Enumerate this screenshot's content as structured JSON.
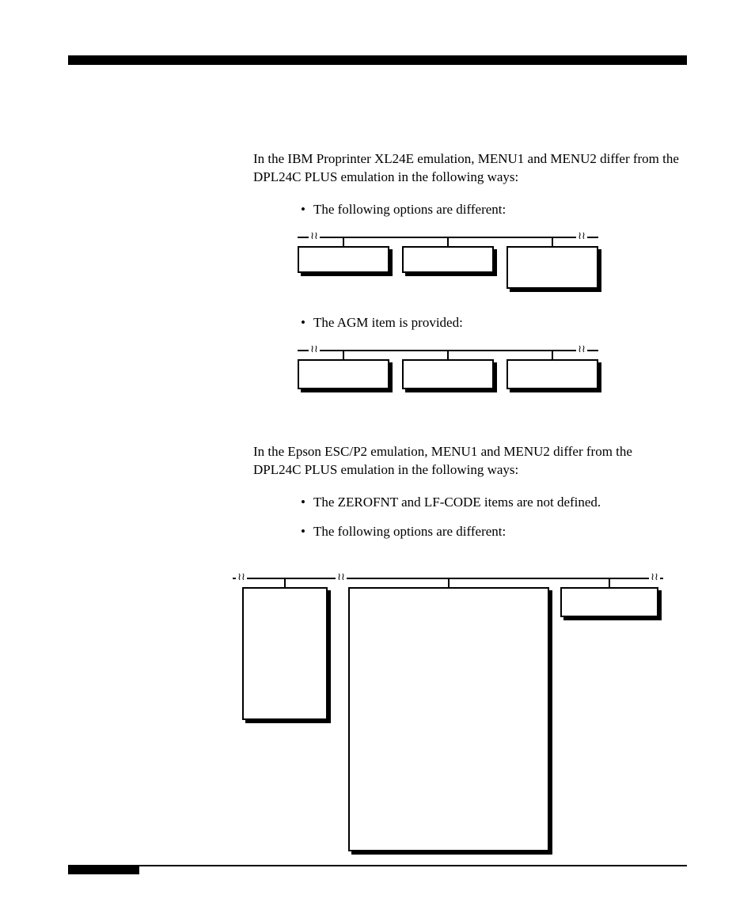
{
  "section1": {
    "intro": "In the IBM Proprinter XL24E emulation, MENU1 and MENU2 differ from the DPL24C PLUS emulation in the following ways:",
    "bullet1": "The following options are different:",
    "bullet2": "The AGM item is provided:"
  },
  "section2": {
    "intro": "In the Epson ESC/P2 emulation, MENU1 and MENU2 differ from the DPL24C PLUS emulation in the following ways:",
    "bullet1": "The  ZEROFNT and LF-CODE items are not defined.",
    "bullet2": "The following options are different:"
  },
  "glyphs": {
    "break": "≀≀"
  }
}
